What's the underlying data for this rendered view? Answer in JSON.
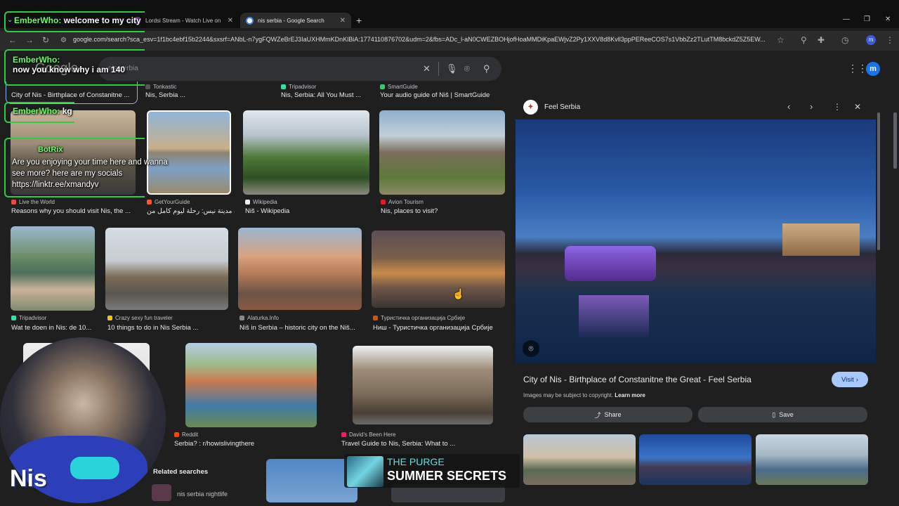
{
  "tabs": [
    {
      "label": "Lordsi Stream - Watch Live on"
    },
    {
      "label": "nis serbia - Google Search"
    }
  ],
  "address": {
    "url": "google.com/search?sca_esv=1f1bc4ebf15b2244&sxsrf=ANbL-n7ygFQWZeBrEJ3IaUXHMmKDnKlBiA:1774110876702&udm=2&fbs=ADc_l-aN0CWEZBOHjofHoaMMDiKpaEWjvZ2Py1XXV8d8Kvll3ppPEReeCOS7s1VbbZz2TLutTM8bckdZ5Z5EW..."
  },
  "search": {
    "logo": "Google",
    "query": "nis serbia"
  },
  "account": {
    "initial": "m"
  },
  "row0": [
    {
      "caption": "City of Nis - Birthplace of Constanitne ..."
    },
    {
      "source": "Tonkastic",
      "caption": "Nis, Serbia ..."
    },
    {
      "source": "Tripadvisor",
      "caption": "Nis, Serbia: All You Must ..."
    },
    {
      "source": "SmartGuide",
      "caption": "Your audio guide of Niš | SmartGuide"
    }
  ],
  "row1": [
    {
      "source": "Live the World",
      "caption": "Reasons why you should visit Nis, the ..."
    },
    {
      "source": "GetYourGuide",
      "caption": "جولة مدينة نيس: رحلة ليوم كامل من ..."
    },
    {
      "source": "Wikipedia",
      "caption": "Niš - Wikipedia"
    },
    {
      "source": "Avion Tourism",
      "caption": "Nis, places to visit?"
    }
  ],
  "row2": [
    {
      "source": "Tripadvisor",
      "caption": "Wat te doen in Nis: de 10..."
    },
    {
      "source": "Crazy sexy fun traveler",
      "caption": "10 things to do in Nis Serbia ..."
    },
    {
      "source": "Alaturka.Info",
      "caption": "Niš in Serbia – historic city on the Niš..."
    },
    {
      "source": "Туристичка организација Србије",
      "caption": "Ниш - Туристичка организација Србије"
    }
  ],
  "row3": [
    {
      "source": "Reddit",
      "caption": "Serbia? : r/howislivingthere"
    },
    {
      "source": "David's Been Here",
      "caption": "Travel Guide to Nis, Serbia: What to ..."
    }
  ],
  "related": {
    "title": "Related searches",
    "item": "nis serbia nightlife"
  },
  "panel": {
    "site": "Feel Serbia",
    "title": "City of Nis - Birthplace of Constanitne the Great - Feel Serbia",
    "visit": "Visit",
    "copyright": "Images may be subject to copyright.",
    "learn": "Learn more",
    "share": "Share",
    "save": "Save"
  },
  "overlay": {
    "chat": [
      {
        "name": "EmberWho:",
        "msg": "welcome to my city"
      },
      {
        "name": "EmberWho:",
        "msg": "now you know why i am 140"
      },
      {
        "name": "EmberWho:",
        "msg": "kg"
      }
    ],
    "bot": {
      "name": "BotRix",
      "msg": "Are you enjoying your time here and wanna see more? here are my socials https://linktr.ee/xmandyv"
    },
    "song": {
      "artist": "THE PURGE",
      "title": "SUMMER SECRETS"
    },
    "corner": "Nis"
  }
}
